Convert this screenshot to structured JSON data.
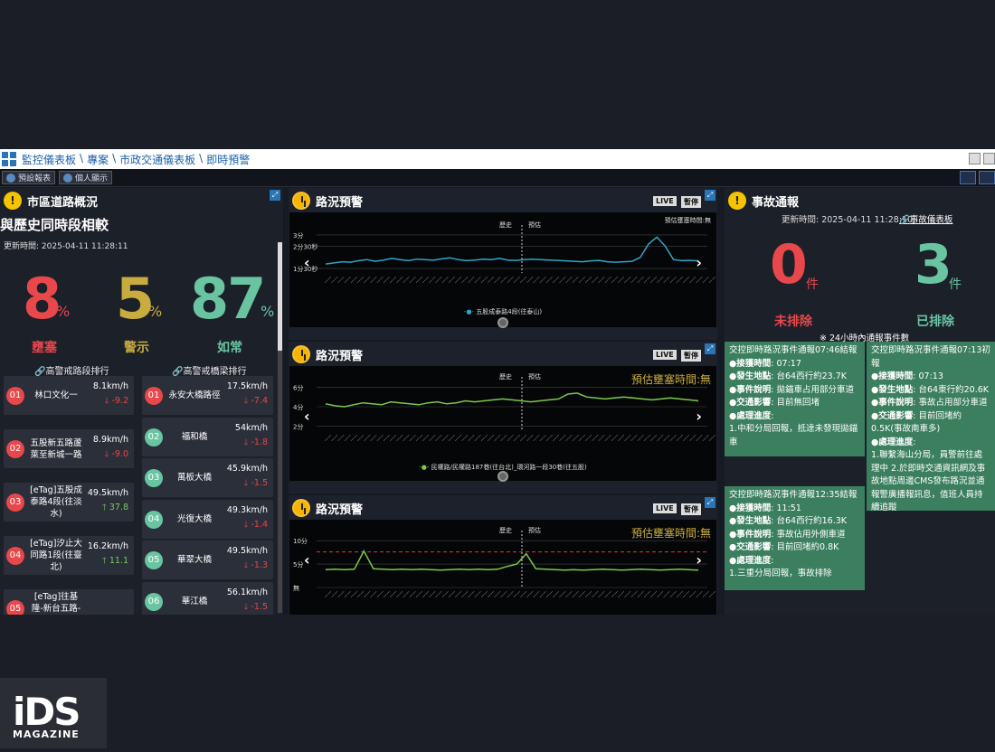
{
  "breadcrumb": [
    "監控儀表板",
    "專案",
    "市政交通儀表板",
    "即時預警"
  ],
  "toolbar": {
    "preset_report": "預設報表",
    "personal_display": "個人顯示"
  },
  "left": {
    "title": "市區道路概況",
    "subtitle": "與歷史同時段相較",
    "updated": "更新時間: 2025-04-11 11:28:11",
    "stats": [
      {
        "value": "8",
        "unit": "%",
        "label": "壅塞",
        "color": "#e8474b"
      },
      {
        "value": "5",
        "unit": "%",
        "label": "警示",
        "color": "#c9ac3e"
      },
      {
        "value": "87",
        "unit": "%",
        "label": "如常",
        "color": "#69c4a2"
      }
    ],
    "road_rank_title": "高警戒路段排行",
    "bridge_rank_title": "高警戒橋梁排行",
    "roads": [
      {
        "no": "01",
        "name": "林口文化一",
        "speed": "8.1km/h",
        "delta": "-9.2",
        "dir": "down",
        "color": "#e8474b"
      },
      {
        "no": "02",
        "name": "五股新五路蘆萊至新城一路",
        "speed": "8.9km/h",
        "delta": "-9.0",
        "dir": "down",
        "color": "#e8474b"
      },
      {
        "no": "03",
        "name": "[eTag]五股成泰路4段(往淡水)",
        "speed": "49.5km/h",
        "delta": "37.8",
        "dir": "up",
        "color": "#e8474b"
      },
      {
        "no": "04",
        "name": "[eTag]汐止大同路1段(往臺北)",
        "speed": "16.2km/h",
        "delta": "11.1",
        "dir": "up",
        "color": "#e8474b"
      },
      {
        "no": "05",
        "name": "[eTag]往基隆-新台五路-大同路",
        "speed": "",
        "delta": "",
        "dir": "",
        "color": "#e8474b"
      }
    ],
    "bridges": [
      {
        "no": "01",
        "name": "永安大橋路徑",
        "speed": "17.5km/h",
        "delta": "-7.4",
        "dir": "down",
        "color": "#e8474b"
      },
      {
        "no": "02",
        "name": "福和橋",
        "speed": "54km/h",
        "delta": "-1.8",
        "dir": "down",
        "color": "#69c4a2"
      },
      {
        "no": "03",
        "name": "萬板大橋",
        "speed": "45.9km/h",
        "delta": "-1.5",
        "dir": "down",
        "color": "#69c4a2"
      },
      {
        "no": "04",
        "name": "光復大橋",
        "speed": "49.3km/h",
        "delta": "-1.4",
        "dir": "down",
        "color": "#69c4a2"
      },
      {
        "no": "05",
        "name": "華翠大橋",
        "speed": "49.5km/h",
        "delta": "-1.3",
        "dir": "down",
        "color": "#69c4a2"
      },
      {
        "no": "06",
        "name": "華江橋",
        "speed": "56.1km/h",
        "delta": "-1.5",
        "dir": "down",
        "color": "#69c4a2"
      }
    ]
  },
  "mid": {
    "panels": [
      {
        "title": "路況預警",
        "live": "LIVE",
        "pause": "暫停",
        "est": "預估壅塞時間:無",
        "hist": "歷史",
        "pred": "預估",
        "legend": "五股成泰路4段(往泰山)",
        "yticks": [
          "3分",
          "2分30秒",
          "1分30秒"
        ],
        "line_color": "#2fa6c8"
      },
      {
        "title": "路況預警",
        "live": "LIVE",
        "pause": "暫停",
        "est": "預估壅塞時間:無",
        "hist": "歷史",
        "pred": "預估",
        "legend": "民權路/民權路187巷(往台北)_環河路一段30巷(往五股)",
        "yticks": [
          "6分",
          "4分",
          "2分"
        ],
        "line_color": "#7cc94a"
      },
      {
        "title": "路況預警",
        "live": "LIVE",
        "pause": "暫停",
        "est": "預估壅塞時間:無",
        "hist": "歷史",
        "pred": "預估",
        "legend": "",
        "yticks": [
          "10分",
          "5分",
          "無"
        ],
        "line_color": "#7cc94a"
      }
    ]
  },
  "right": {
    "title": "事故通報",
    "updated": "更新時間: 2025-04-11 11:28:10",
    "dash_link": "事故儀表板",
    "unresolved": {
      "value": "0",
      "unit": "件",
      "label": "未排除",
      "color": "#e8474b"
    },
    "resolved": {
      "value": "3",
      "unit": "件",
      "label": "已排除",
      "color": "#69c4a2"
    },
    "note": "※ 24小時內通報事件數",
    "incidents": [
      {
        "head": "交控即時路況事件通報07:46結報",
        "time_l": "●接獲時間",
        "time": ": 07:17",
        "loc_l": "●發生地點",
        "loc": ": 台64西行約23.7K",
        "desc_l": "●事件說明",
        "desc": ": 拋錨車占用部分車道",
        "imp_l": "●交通影響",
        "imp": ": 目前無回堵",
        "prog_l": "●處理進度",
        "prog": ":",
        "detail": "1.中和分局回報，抵達未發現拋錨車"
      },
      {
        "head": "交控即時路況事件通報07:13初報",
        "time_l": "●接獲時間",
        "time": ": 07:13",
        "loc_l": "●發生地點",
        "loc": ": 台64東行約20.6K",
        "desc_l": "●事件說明",
        "desc": ": 事故占用部分車道",
        "imp_l": "●交通影響",
        "imp": ": 目前回堵約0.5K(事故南車多)",
        "prog_l": "●處理進度",
        "prog": ":",
        "detail": "1.聯繫海山分局，員警前往處理中 2.於即時交通資訊網及事故地點周邊CMS發布路況並通報警廣播報訊息，值班人員持續追蹤"
      },
      {
        "head": "交控即時路況事件通報12:35結報",
        "time_l": "●接獲時間",
        "time": ": 11:51",
        "loc_l": "●發生地點",
        "loc": ": 台64西行約16.3K",
        "desc_l": "●事件說明",
        "desc": ": 事故佔用外側車道",
        "imp_l": "●交通影響",
        "imp": ": 目前回堵約0.8K",
        "prog_l": "●處理進度",
        "prog": ":",
        "detail": "1.三重分局回報，事故排除"
      }
    ]
  },
  "watermark": "iDS MAGAZINE"
}
